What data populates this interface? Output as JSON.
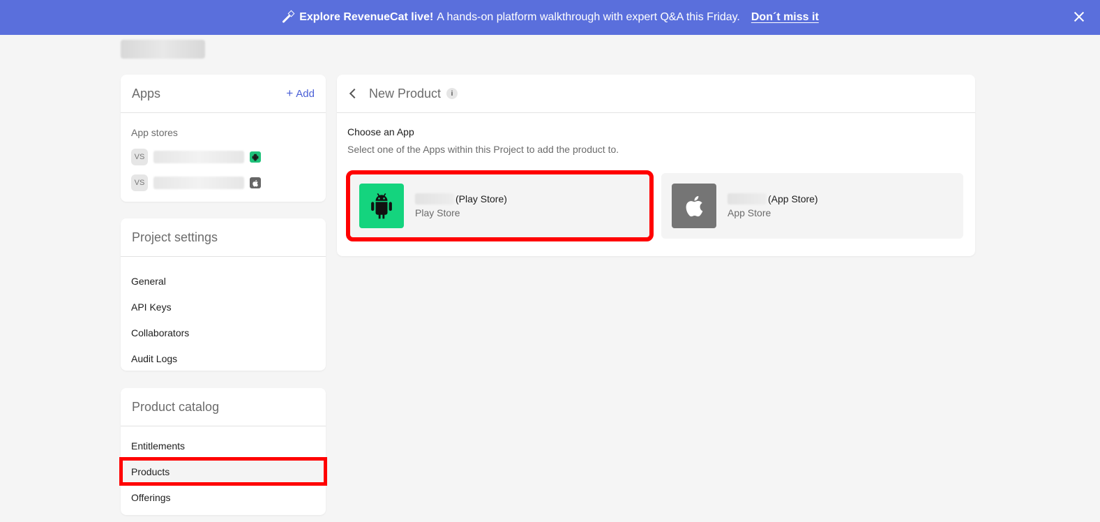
{
  "banner": {
    "headline": "Explore RevenueCat live!",
    "message": "A hands-on platform walkthrough with expert Q&A this Friday.",
    "cta": "Don´t miss it"
  },
  "apps_panel": {
    "title": "Apps",
    "add_label": "Add",
    "section_label": "App stores",
    "items": [
      {
        "initials": "VS",
        "store_icon": "android-icon"
      },
      {
        "initials": "VS",
        "store_icon": "apple-icon"
      }
    ]
  },
  "project_settings": {
    "title": "Project settings",
    "items": [
      "General",
      "API Keys",
      "Collaborators",
      "Audit Logs"
    ]
  },
  "product_catalog": {
    "title": "Product catalog",
    "items": [
      "Entitlements",
      "Products",
      "Offerings"
    ],
    "selected": "Products"
  },
  "main": {
    "title": "New Product",
    "info_glyph": "i",
    "choose_title": "Choose an App",
    "choose_subtitle": "Select one of the Apps within this Project to add the product to.",
    "apps": [
      {
        "name_suffix": "(Play Store)",
        "store": "Play Store",
        "icon": "android-icon",
        "color": "#14d47e"
      },
      {
        "name_suffix": "(App Store)",
        "store": "App Store",
        "icon": "apple-icon",
        "color": "#757575"
      }
    ]
  },
  "colors": {
    "banner": "#5a6fdc",
    "accent": "#4a5fd6",
    "highlight": "#ff0000"
  }
}
